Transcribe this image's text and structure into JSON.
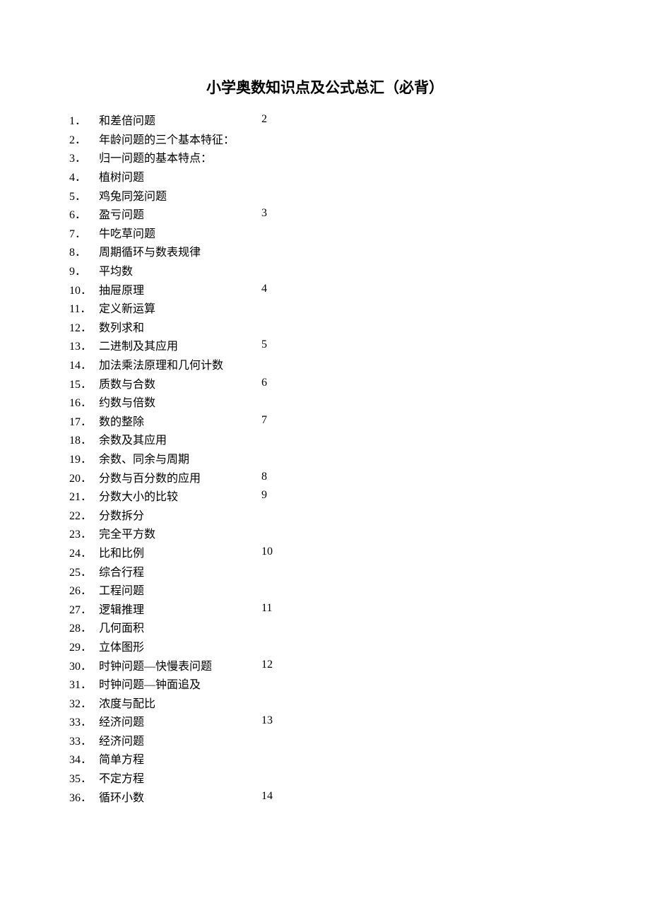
{
  "title": "小学奥数知识点及公式总汇（必背）",
  "toc": [
    {
      "num": "1．",
      "label": "和差倍问题",
      "page": "2"
    },
    {
      "num": "2．",
      "label": "年龄问题的三个基本特征：",
      "page": ""
    },
    {
      "num": "3．",
      "label": "归一问题的基本特点：",
      "page": ""
    },
    {
      "num": "4．",
      "label": "植树问题",
      "page": ""
    },
    {
      "num": "5．",
      "label": "鸡兔同笼问题",
      "page": ""
    },
    {
      "num": "6．",
      "label": "盈亏问题",
      "page": "3"
    },
    {
      "num": "7．",
      "label": "牛吃草问题",
      "page": ""
    },
    {
      "num": "8．",
      "label": "周期循环与数表规律",
      "page": ""
    },
    {
      "num": "9．",
      "label": "平均数",
      "page": ""
    },
    {
      "num": "10．",
      "label": "抽屉原理",
      "page": "4"
    },
    {
      "num": "11．",
      "label": "定义新运算",
      "page": ""
    },
    {
      "num": "12．",
      "label": "数列求和",
      "page": ""
    },
    {
      "num": "13．",
      "label": "二进制及其应用",
      "page": "5"
    },
    {
      "num": "14．",
      "label": "加法乘法原理和几何计数",
      "page": ""
    },
    {
      "num": "15．",
      "label": "质数与合数",
      "page": "6"
    },
    {
      "num": "16．",
      "label": "约数与倍数",
      "page": ""
    },
    {
      "num": "17．",
      "label": "数的整除",
      "page": "7"
    },
    {
      "num": "18．",
      "label": "余数及其应用",
      "page": ""
    },
    {
      "num": "19．",
      "label": "余数、同余与周期",
      "page": ""
    },
    {
      "num": "20．",
      "label": "分数与百分数的应用",
      "page": "8"
    },
    {
      "num": "21．",
      "label": "分数大小的比较",
      "page": "9"
    },
    {
      "num": "22．",
      "label": "分数拆分",
      "page": ""
    },
    {
      "num": "23．",
      "label": "完全平方数",
      "page": ""
    },
    {
      "num": "24．",
      "label": "比和比例",
      "page": "10"
    },
    {
      "num": "25．",
      "label": "综合行程",
      "page": ""
    },
    {
      "num": "26．",
      "label": "工程问题",
      "page": ""
    },
    {
      "num": "27．",
      "label": "逻辑推理",
      "page": "11"
    },
    {
      "num": "28．",
      "label": "几何面积",
      "page": ""
    },
    {
      "num": "29．",
      "label": "立体图形",
      "page": ""
    },
    {
      "num": "30．",
      "label": "时钟问题—快慢表问题",
      "page": "12"
    },
    {
      "num": "31．",
      "label": "时钟问题—钟面追及",
      "page": ""
    },
    {
      "num": "32．",
      "label": "浓度与配比",
      "page": ""
    },
    {
      "num": "33．",
      "label": "经济问题",
      "page": "13"
    },
    {
      "num": "33．",
      "label": "经济问题",
      "page": ""
    },
    {
      "num": "34．",
      "label": "简单方程",
      "page": ""
    },
    {
      "num": "35．",
      "label": "不定方程",
      "page": ""
    },
    {
      "num": "36．",
      "label": "循环小数",
      "page": "14"
    }
  ]
}
